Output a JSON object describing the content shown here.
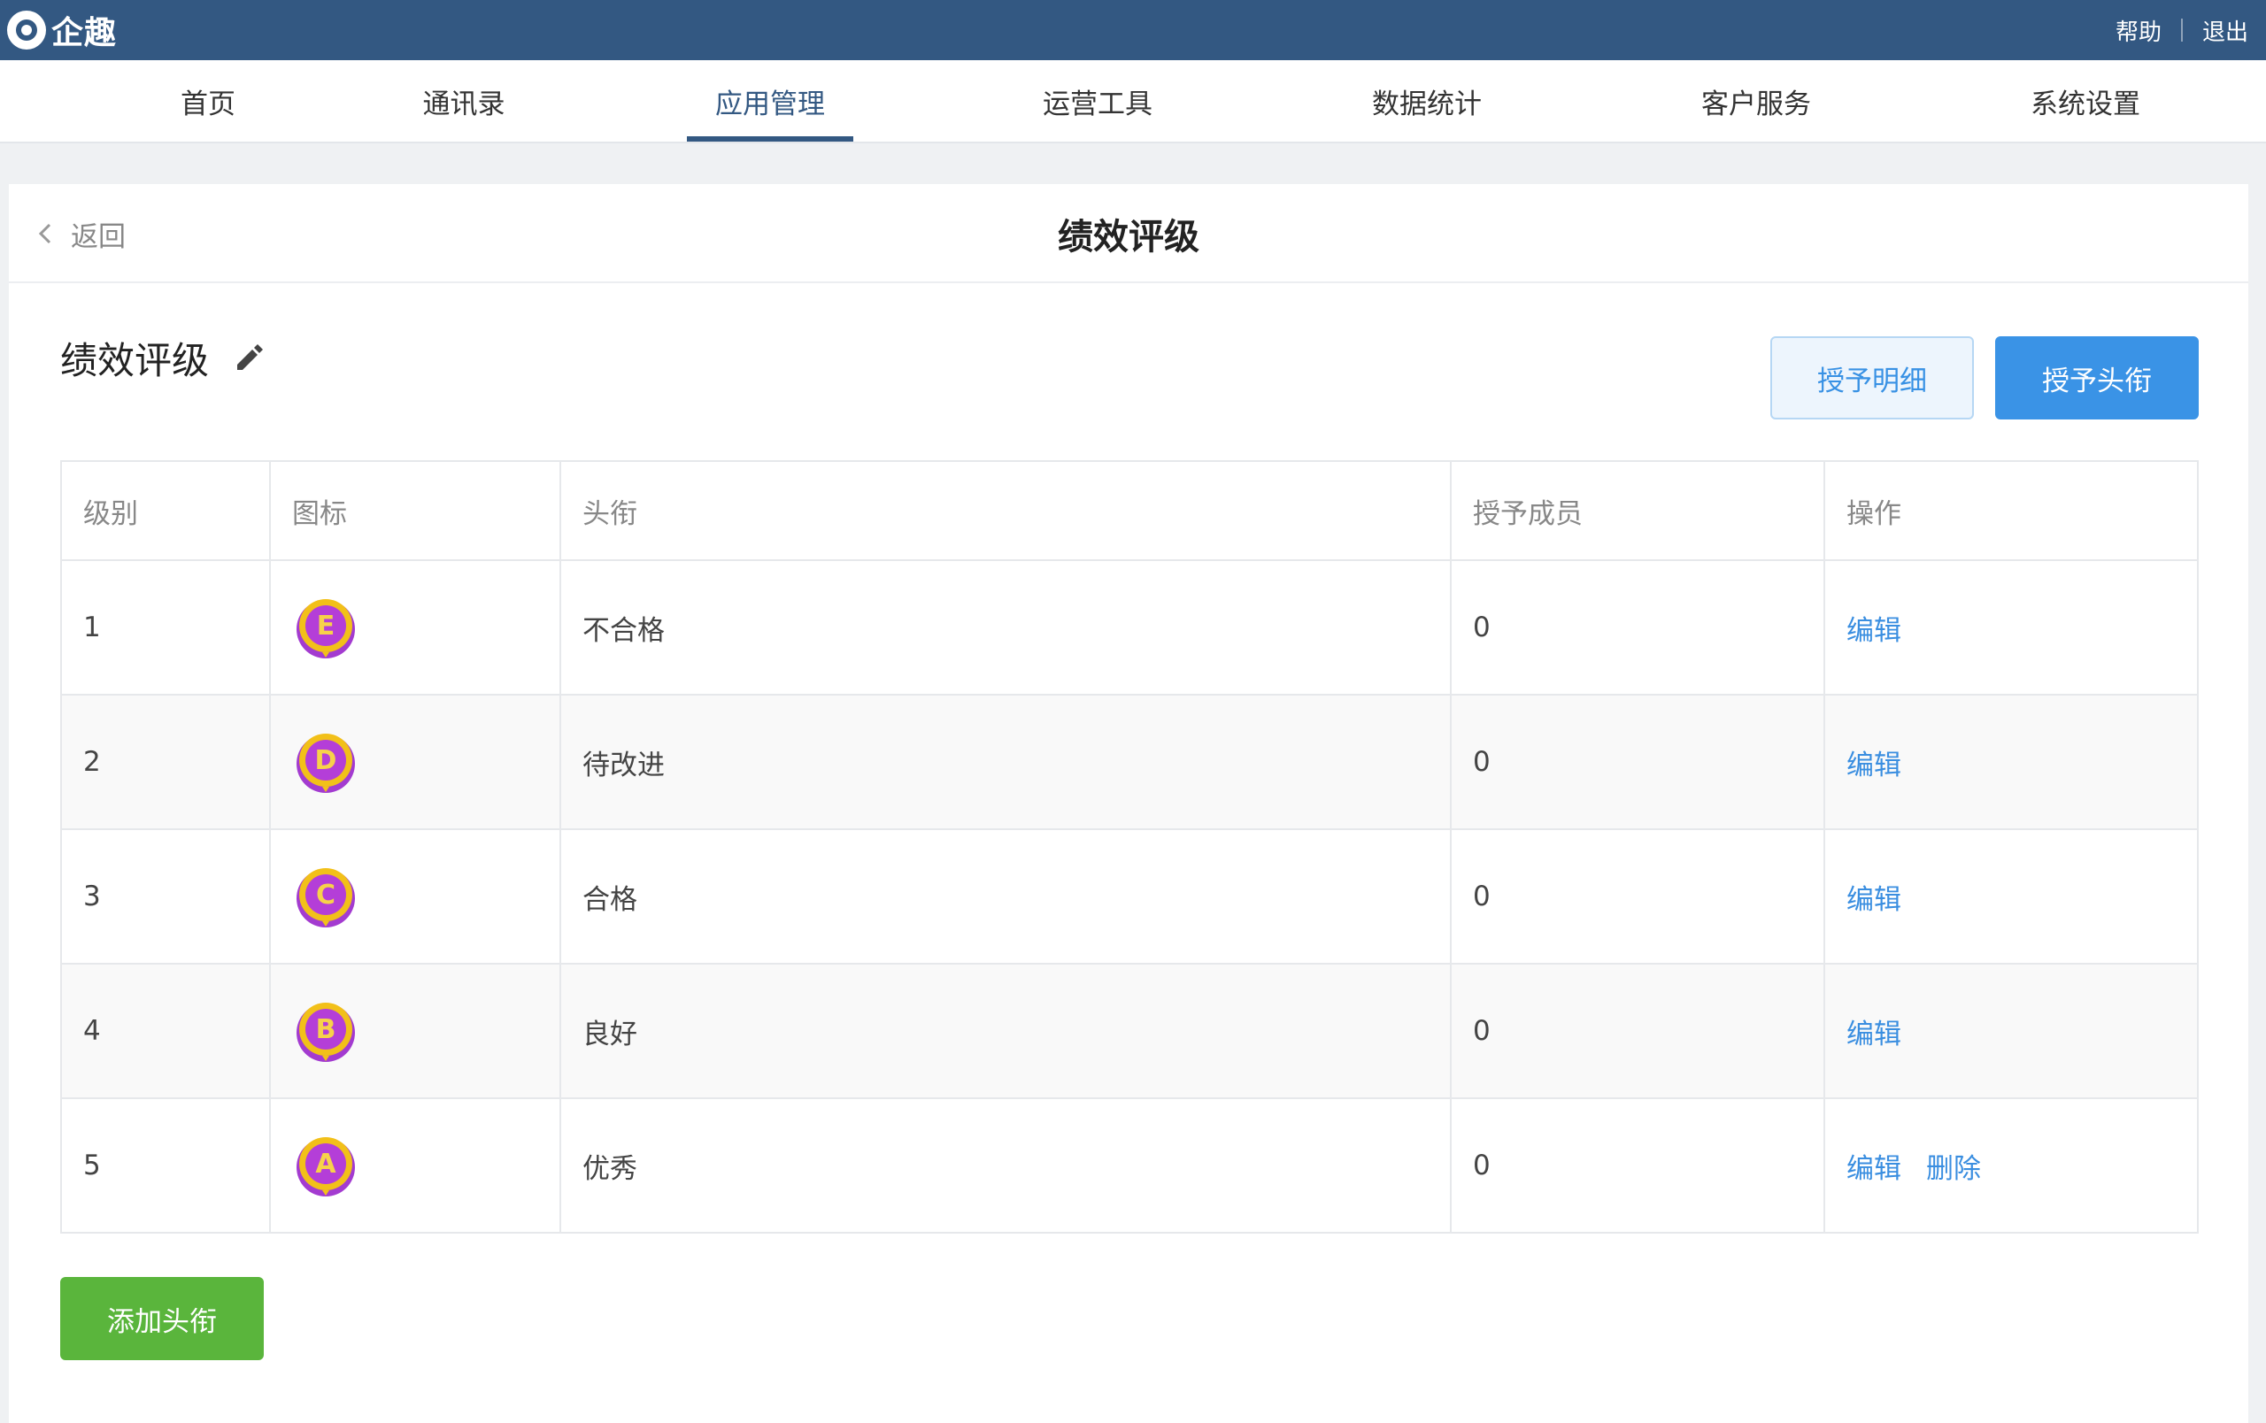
{
  "app": {
    "name": "企趣",
    "help_label": "帮助",
    "logout_label": "退出"
  },
  "nav": {
    "items": [
      {
        "label": "首页"
      },
      {
        "label": "通讯录"
      },
      {
        "label": "应用管理"
      },
      {
        "label": "运营工具"
      },
      {
        "label": "数据统计"
      },
      {
        "label": "客户服务"
      },
      {
        "label": "系统设置"
      }
    ],
    "active": "应用管理"
  },
  "page": {
    "back_label": "返回",
    "title": "绩效评级",
    "section_title": "绩效评级",
    "grant_detail_label": "授予明细",
    "grant_title_label": "授予头衔",
    "add_title_label": "添加头衔"
  },
  "table": {
    "columns": [
      "级别",
      "图标",
      "头衔",
      "授予成员",
      "操作"
    ],
    "rows": [
      {
        "level": "1",
        "icon": "E",
        "title": "不合格",
        "members": "0",
        "edit": "编辑"
      },
      {
        "level": "2",
        "icon": "D",
        "title": "待改进",
        "members": "0",
        "edit": "编辑"
      },
      {
        "level": "3",
        "icon": "C",
        "title": "合格",
        "members": "0",
        "edit": "编辑"
      },
      {
        "level": "4",
        "icon": "B",
        "title": "良好",
        "members": "0",
        "edit": "编辑"
      },
      {
        "level": "5",
        "icon": "A",
        "title": "优秀",
        "members": "0",
        "edit": "编辑",
        "delete": "删除"
      }
    ]
  },
  "colors": {
    "topbar": "#335882",
    "primary": "#3a93e6",
    "success": "#5ab53c",
    "link": "#3a8ee0"
  }
}
